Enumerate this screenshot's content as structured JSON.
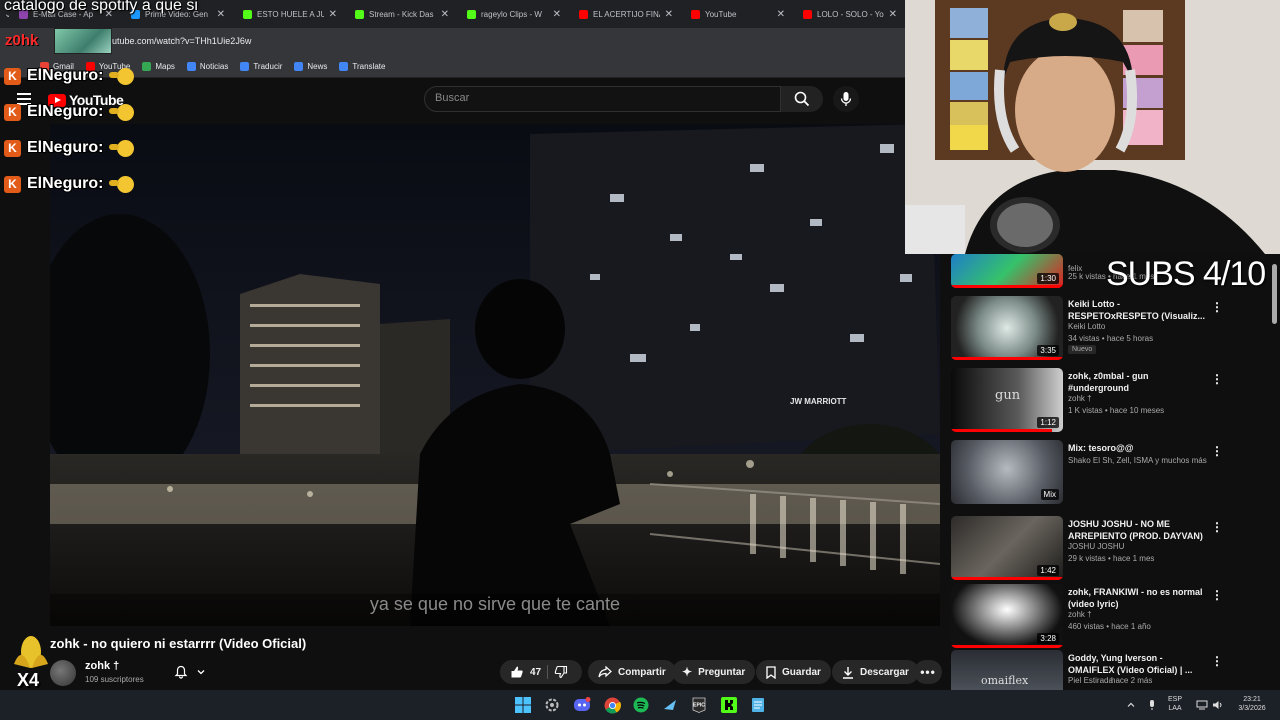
{
  "overlay": {
    "stream_title": "catalogo de spotify a que si",
    "streamer_name": "z0hk",
    "chat": [
      {
        "badge": "K",
        "name": "ElNeguro:"
      },
      {
        "badge": "K",
        "name": "ElNeguro:"
      },
      {
        "badge": "K",
        "name": "ElNeguro:"
      },
      {
        "badge": "K",
        "name": "ElNeguro:"
      }
    ],
    "subs_counter": "SUBS 4/10",
    "multiplier": "X4"
  },
  "browser": {
    "tabs": [
      {
        "label": "E-Mail Case - Ap",
        "color": "#8e44ad"
      },
      {
        "label": "Prime Video: Gen",
        "color": "#1a98ff"
      },
      {
        "label": "ESTO HUELE A JU",
        "color": "#53fc18"
      },
      {
        "label": "Stream - Kick Das",
        "color": "#53fc18"
      },
      {
        "label": "rageylo Clips - W",
        "color": "#53fc18"
      },
      {
        "label": "EL ACERTIJO FINA",
        "color": "#ff0000"
      },
      {
        "label": "YouTube",
        "color": "#ff0000"
      },
      {
        "label": "LOLO - SOLO - Yo",
        "color": "#ff0000"
      }
    ],
    "url": "utube.com/watch?v=THh1Uie2J6w",
    "bookmarks": [
      {
        "label": "Gmail",
        "color": "#ea4335"
      },
      {
        "label": "YouTube",
        "color": "#ff0000"
      },
      {
        "label": "Maps",
        "color": "#34a853"
      },
      {
        "label": "Noticias",
        "color": "#4285f4"
      },
      {
        "label": "Traducir",
        "color": "#4285f4"
      },
      {
        "label": "News",
        "color": "#4285f4"
      },
      {
        "label": "Translate",
        "color": "#4285f4"
      }
    ]
  },
  "youtube": {
    "logo_text": "YouTube",
    "search_placeholder": "Buscar",
    "video": {
      "subtitle": "ya se que no sirve que te cante",
      "title": "zohk - no quiero ni estarrrr (Video Oficial)",
      "channel": "zohk †",
      "subscribers": "109 suscriptores",
      "likes": "47",
      "actions": {
        "share": "Compartir",
        "ask": "Preguntar",
        "save": "Guardar",
        "download": "Descargar"
      }
    },
    "recommendations": [
      {
        "title": "",
        "channel": "felix",
        "stats": "25 k vistas • hace 1 mes",
        "duration": "1:30",
        "progress": 1.0,
        "thumb": "linear-gradient(135deg,#1e7ec8,#36c26a 50%,#e02020)"
      },
      {
        "title": "Keiki Lotto - RESPETOxRESPETO (Visualiz...",
        "channel": "Keiki Lotto",
        "stats": "34 vistas • hace 5 horas",
        "badge": "Nuevo",
        "duration": "3:35",
        "progress": 1.0,
        "thumb": "radial-gradient(circle at 50% 50%,#dfe9e6,#7a8a86 45%,#222 80%)"
      },
      {
        "title": "zohk, z0mbal - gun #underground",
        "channel": "zohk †",
        "stats": "1 K vistas • hace 10 meses",
        "duration": "1:12",
        "progress": 0.9,
        "thumb": "linear-gradient(90deg,#0a0a0a,#5a5a5a 60%,#cfcfcf)"
      },
      {
        "title": "Mix: tesoro@@",
        "channel": "Shako El Sh, Zell, ISMA y muchos más",
        "stats": "",
        "duration": "Mix",
        "progress": 0,
        "thumb": "radial-gradient(circle at 50% 45%,#b5b9c0,#575b63 60%,#2a2c31)"
      },
      {
        "title": "JOSHU JOSHU - NO ME ARREPIENTO (PROD. DAYVAN)",
        "channel": "JOSHU JOSHU",
        "stats": "29 k vistas • hace 1 mes",
        "duration": "1:42",
        "progress": 1.0,
        "thumb": "linear-gradient(135deg,#2d2b29,#6a655e 50%,#1c1b1a)"
      },
      {
        "title": "zohk, FRANKIWI - no es normal (video lyric)",
        "channel": "zohk †",
        "stats": "460 vistas • hace 1 año",
        "duration": "3:28",
        "progress": 1.0,
        "thumb": "radial-gradient(ellipse at 50% 40%,#ffffff,#9a9a9a 30%,#111 70%)"
      },
      {
        "title": "Goddy, Yung Iverson - OMAIFLEX (Video Oficial) | ...",
        "channel": "Piel Estirada",
        "stats": "hace 2 más",
        "duration": "",
        "progress": 0,
        "thumb": "linear-gradient(180deg,#2a2d33,#5f6670)"
      }
    ],
    "rec_overlay_text": [
      "gun",
      "omaiflex"
    ]
  },
  "taskbar": {
    "lang": "ESP",
    "region": "LAA",
    "time": "23:21",
    "date": "3/3/2026"
  }
}
